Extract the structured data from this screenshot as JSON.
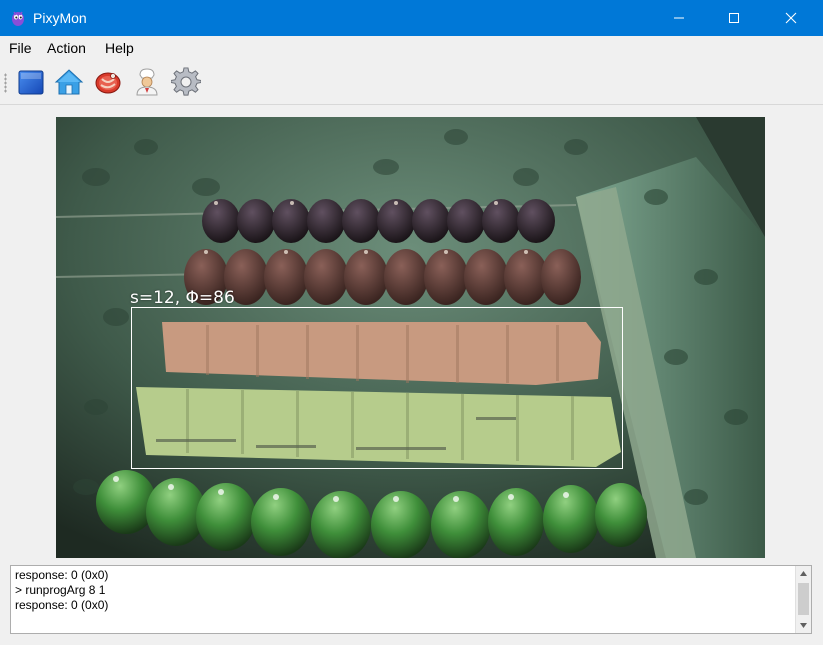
{
  "window": {
    "title": "PixyMon",
    "title_bar_color": "#0078d7",
    "controls": {
      "minimize_icon": "minimize-icon",
      "maximize_icon": "maximize-icon",
      "close_icon": "close-icon"
    }
  },
  "menu": {
    "items": [
      {
        "label": "File"
      },
      {
        "label": "Action"
      },
      {
        "label": "Help"
      }
    ]
  },
  "toolbar": {
    "buttons": [
      {
        "icon": "blue-square-icon"
      },
      {
        "icon": "home-icon"
      },
      {
        "icon": "meat-icon"
      },
      {
        "icon": "chef-icon"
      },
      {
        "icon": "gear-icon"
      }
    ]
  },
  "video": {
    "detection_label": "s=12, Φ=86",
    "box_color": "#ffffff"
  },
  "console": {
    "lines": [
      "response: 0 (0x0)",
      "> runprogArg 8 1",
      "response: 0 (0x0)"
    ]
  }
}
